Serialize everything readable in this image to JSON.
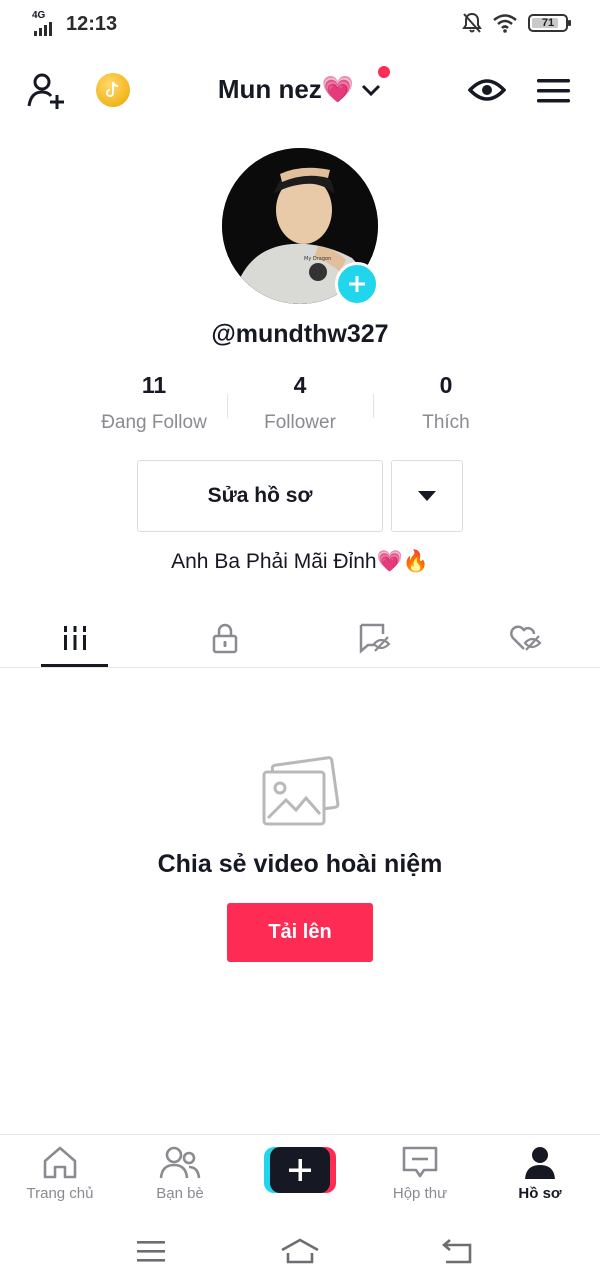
{
  "status_bar": {
    "network": "4G",
    "time": "12:13",
    "battery": "71",
    "battery_level": 0.71
  },
  "header": {
    "title": "Mun nez💗",
    "icons": [
      "add-user-icon",
      "coin-icon",
      "chevron-down-icon",
      "eye-icon",
      "menu-icon"
    ],
    "notification_color": "#fe2c55"
  },
  "profile": {
    "username": "@mundthw327",
    "avatar_badge_color": "#20d5ec",
    "stats": [
      {
        "value": "11",
        "label": "Đang Follow"
      },
      {
        "value": "4",
        "label": "Follower"
      },
      {
        "value": "0",
        "label": "Thích"
      }
    ],
    "edit_button": "Sửa hồ sơ",
    "bio": "Anh Ba Phải Mãi Đỉnh💗🔥"
  },
  "tabs": [
    {
      "icon": "grid-icon",
      "active": true
    },
    {
      "icon": "lock-icon",
      "active": false
    },
    {
      "icon": "tag-hidden-icon",
      "active": false
    },
    {
      "icon": "heart-hidden-icon",
      "active": false
    }
  ],
  "empty_state": {
    "icon": "photo-icon",
    "title": "Chia sẻ video hoài niệm",
    "button": "Tải lên",
    "button_color": "#fe2c55"
  },
  "bottom_nav": [
    {
      "icon": "home-icon",
      "label": "Trang chủ",
      "active": false
    },
    {
      "icon": "friends-icon",
      "label": "Bạn bè",
      "active": false
    },
    {
      "icon": "create-icon",
      "label": "",
      "active": false
    },
    {
      "icon": "inbox-icon",
      "label": "Hộp thư",
      "active": false
    },
    {
      "icon": "profile-icon",
      "label": "Hồ sơ",
      "active": true
    }
  ],
  "system_nav": [
    "menu-icon",
    "home-icon",
    "back-icon"
  ]
}
